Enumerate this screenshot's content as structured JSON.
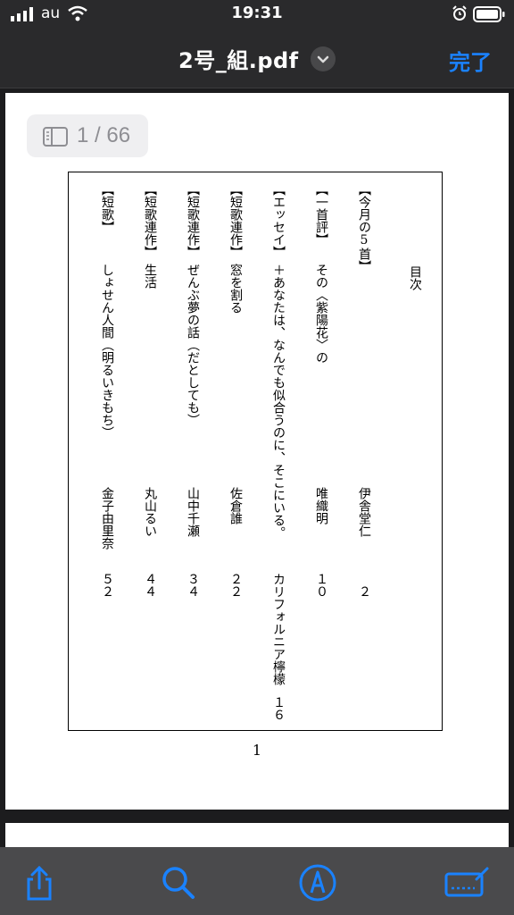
{
  "status_bar": {
    "carrier": "au",
    "time": "19:31"
  },
  "nav": {
    "title": "2号_組.pdf",
    "done_label": "完了"
  },
  "page_indicator": {
    "text": "1 / 66"
  },
  "toc": {
    "title": "目次",
    "entries": [
      {
        "category": "【今月の5首】",
        "subtitle": "",
        "author": "伊舎堂仁",
        "page": "２"
      },
      {
        "category": "【一首評】",
        "subtitle": "その〈紫陽花〉の",
        "author": "唯織明",
        "page": "１０"
      },
      {
        "category": "【エッセイ】",
        "subtitle": "＋あなたは、なんでも似合うのに、そこにいる。",
        "author": "カリフォルニア檸檬",
        "page": "１６"
      },
      {
        "category": "【短歌連作】",
        "subtitle": "窓を割る",
        "author": "佐倉誰",
        "page": "２２"
      },
      {
        "category": "【短歌連作】",
        "subtitle": "ぜんぶ夢の話（だとしても）",
        "author": "山中千瀬",
        "page": "３４"
      },
      {
        "category": "【短歌連作】",
        "subtitle": "生活",
        "author": "丸山るい",
        "page": "４４"
      },
      {
        "category": "【短歌】",
        "subtitle": "しょせん人間（明るいきもち）",
        "author": "金子由里奈",
        "page": "５２"
      }
    ],
    "page_number": "1"
  },
  "colors": {
    "accent": "#1a82ff",
    "bar_bg": "#2a2a2c",
    "toolbar_bg": "#4a4a4c"
  },
  "icons": {
    "signal": "signal-icon",
    "wifi": "wifi-icon",
    "alarm": "alarm-icon",
    "battery": "battery-icon",
    "chevron": "chevron-down-icon",
    "sidebar": "sidebar-icon",
    "share": "share-icon",
    "search": "search-icon",
    "markup": "markup-icon",
    "keyboard": "keyboard-sign-icon"
  }
}
